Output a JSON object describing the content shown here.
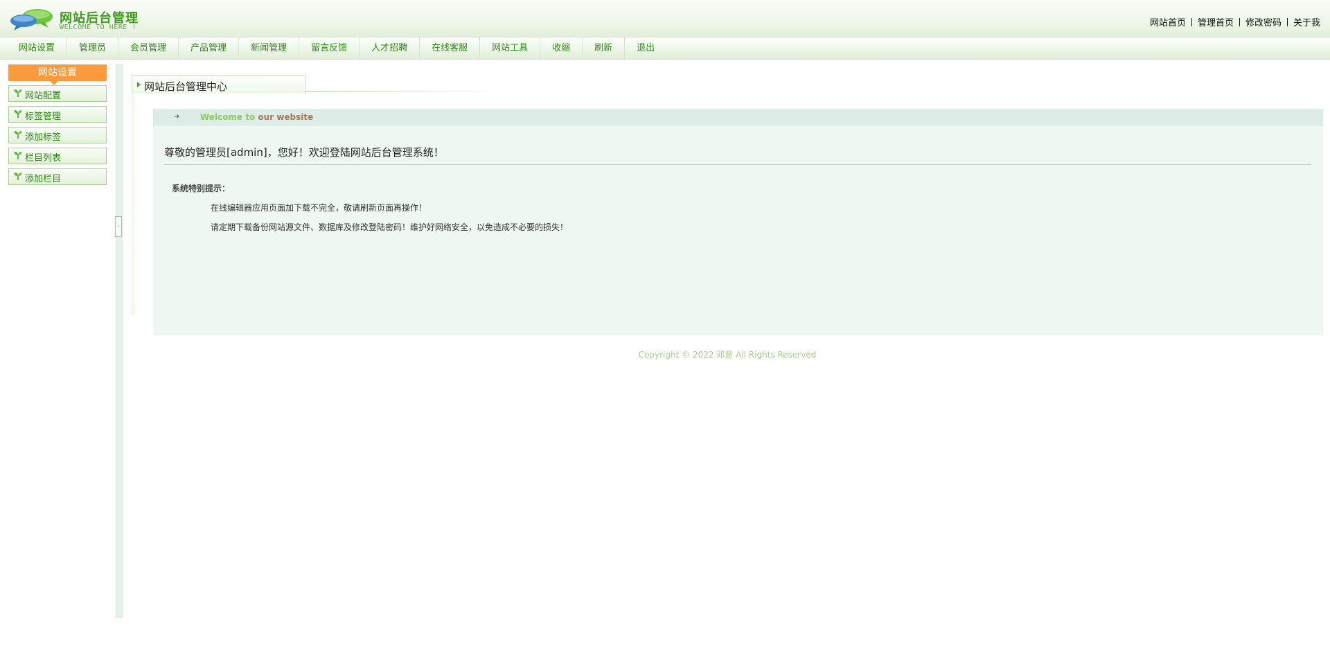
{
  "header": {
    "brand_title": "网站后台管理",
    "brand_subtitle": "WELCOME TO HERE !",
    "links": [
      "网站首页",
      "管理首页",
      "修改密码",
      "关于我"
    ]
  },
  "menu": {
    "items": [
      "网站设置",
      "管理员",
      "会员管理",
      "产品管理",
      "新闻管理",
      "留言反馈",
      "人才招聘",
      "在线客服",
      "网站工具",
      "收缩",
      "刷新",
      "退出"
    ]
  },
  "sidebar": {
    "title": "网站设置",
    "items": [
      "网站配置",
      "标签管理",
      "添加标签",
      "栏目列表",
      "添加栏目"
    ]
  },
  "main": {
    "tab_title": "网站后台管理中心",
    "welcome_prefix": "Welcome to",
    "welcome_suffix": "our website",
    "greeting": "尊敬的管理员[admin]，您好！欢迎登陆网站后台管理系统！",
    "tips_title": "系统特别提示：",
    "tips": [
      "在线编辑器应用页面加下载不完全，敬请刷新页面再操作！",
      "请定期下载备份网站源文件、数据库及修改登陆密码！维护好网络安全，以免造成不必要的损失！"
    ]
  },
  "footer": {
    "copyright": "Copyright © 2022  邓意  All Rights Reserved"
  },
  "colors": {
    "brand_green": "#3f9a1f",
    "menu_text": "#2e8a12",
    "sidebar_header": "#fb9b3d",
    "panel_bg": "#eff7f2"
  }
}
